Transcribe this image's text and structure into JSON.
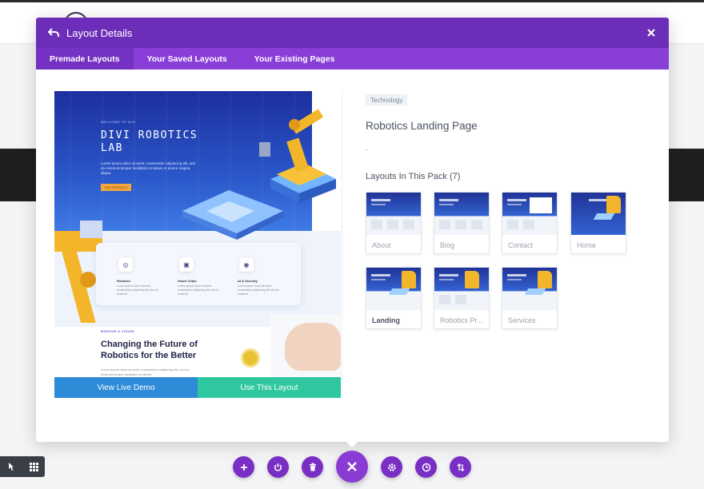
{
  "modal": {
    "title": "Layout Details",
    "tabs": [
      {
        "label": "Premade Layouts",
        "active": true
      },
      {
        "label": "Your Saved Layouts",
        "active": false
      },
      {
        "label": "Your Existing Pages",
        "active": false
      }
    ]
  },
  "preview": {
    "welcome": "WELCOME TO DIVI",
    "hero_title_line1": "DIVI ROBOTICS",
    "hero_title_line2": "LAB",
    "hero_text": "Lorem ipsum dolor sit amet, consectetur adipiscing elit, sed do eiusmod tempor incididunt ut labore et dolore magna aliqua.",
    "hero_button": "OUR PRODUCTS",
    "features": [
      {
        "label": "Robotics",
        "text": "Lorem ipsum dolor sit amet consectetur adipiscing elit sed do eiusmod"
      },
      {
        "label": "Smart Chips",
        "text": "Lorem ipsum dolor sit amet consectetur adipiscing elit sed do eiusmod"
      },
      {
        "label": "AI & Security",
        "text": "Lorem ipsum dolor sit amet consectetur adipiscing elit sed do eiusmod"
      }
    ],
    "mission": "MISSION & VISION",
    "heading": "Changing the Future of Robotics for the Better",
    "paragraph": "Lorem ipsum dolor sit amet, consectetur adipiscing elit, sed do eiusmod tempor incididunt ut labore."
  },
  "buttons": {
    "live_demo": "View Live Demo",
    "use_layout": "Use This Layout"
  },
  "details": {
    "category": "Technology",
    "title": "Robotics Landing Page",
    "description": ".",
    "pack_title": "Layouts In This Pack (7)",
    "layouts": [
      {
        "label": "About",
        "active": false
      },
      {
        "label": "Blog",
        "active": false
      },
      {
        "label": "Contact",
        "active": false
      },
      {
        "label": "Home",
        "active": false
      },
      {
        "label": "Landing",
        "active": true
      },
      {
        "label": "Robotics Pr...",
        "active": false
      },
      {
        "label": "Services",
        "active": false
      }
    ]
  },
  "icons": {
    "back": "back-arrow-icon",
    "close": "close-icon",
    "add": "plus-icon",
    "power": "power-icon",
    "trash": "trash-icon",
    "main_close": "close-icon",
    "settings": "gear-icon",
    "history": "clock-icon",
    "portability": "sort-arrows-icon",
    "hover": "pointer-icon",
    "grid": "grid-icon"
  },
  "colors": {
    "header": "#6c2eb9",
    "tabs": "#8a3ed8",
    "fab": "#7a2fc4",
    "demo_button": "#2e8bd8",
    "use_button": "#2fc7a0"
  }
}
